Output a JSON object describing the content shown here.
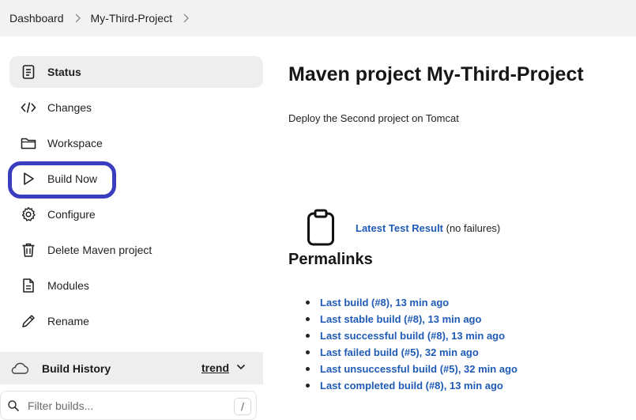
{
  "breadcrumb": {
    "items": [
      {
        "label": "Dashboard"
      },
      {
        "label": "My-Third-Project"
      }
    ]
  },
  "sidebar": {
    "items": [
      {
        "label": "Status",
        "icon": "status-document-icon",
        "active": true
      },
      {
        "label": "Changes",
        "icon": "code-icon"
      },
      {
        "label": "Workspace",
        "icon": "folder-icon"
      },
      {
        "label": "Build Now",
        "icon": "play-icon",
        "highlighted": true
      },
      {
        "label": "Configure",
        "icon": "gear-icon"
      },
      {
        "label": "Delete Maven project",
        "icon": "trash-icon"
      },
      {
        "label": "Modules",
        "icon": "document-icon"
      },
      {
        "label": "Rename",
        "icon": "pencil-icon"
      }
    ],
    "build_history": {
      "title": "Build History",
      "trend_label": "trend",
      "icon": "cloud-icon"
    },
    "filter": {
      "placeholder": "Filter builds...",
      "shortcut": "/"
    }
  },
  "main": {
    "title": "Maven project My-Third-Project",
    "description": "Deploy the Second project on Tomcat",
    "test_result": {
      "link_text": "Latest Test Result",
      "suffix": " (no failures)",
      "icon": "clipboard-icon"
    },
    "permalinks_title": "Permalinks",
    "permalinks": [
      "Last build (#8), 13 min ago",
      "Last stable build (#8), 13 min ago",
      "Last successful build (#8), 13 min ago",
      "Last failed build (#5), 32 min ago",
      "Last unsuccessful build (#5), 32 min ago",
      "Last completed build (#8), 13 min ago"
    ]
  },
  "colors": {
    "link": "#1f5bb5",
    "highlight_ring": "#3b3dbf",
    "active_bg": "#eeeeef",
    "breadcrumb_bg": "#f2f2f3"
  }
}
